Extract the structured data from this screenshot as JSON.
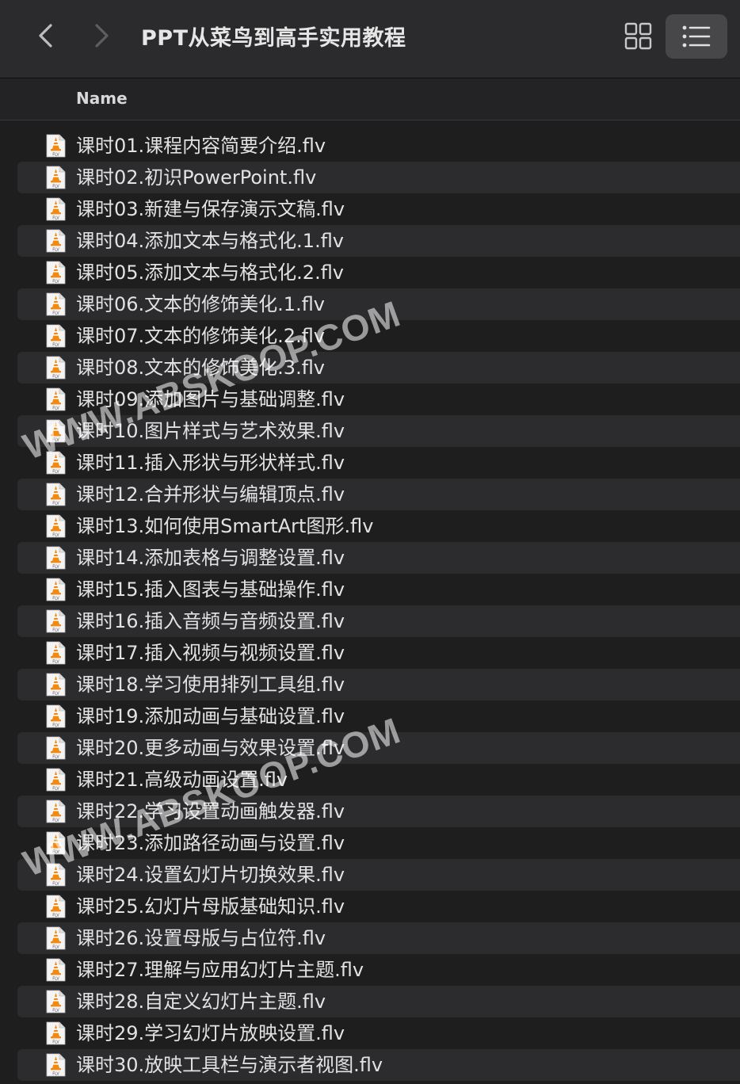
{
  "window": {
    "title": "PPT从菜鸟到高手实用教程"
  },
  "toolbar": {
    "back_icon": "chevron-left-icon",
    "forward_icon": "chevron-right-icon",
    "grid_view_icon": "grid-view-icon",
    "list_view_icon": "list-view-icon"
  },
  "header": {
    "name_label": "Name"
  },
  "files": [
    "课时01.课程内容简要介绍.flv",
    "课时02.初识PowerPoint.flv",
    "课时03.新建与保存演示文稿.flv",
    "课时04.添加文本与格式化.1.flv",
    "课时05.添加文本与格式化.2.flv",
    "课时06.文本的修饰美化.1.flv",
    "课时07.文本的修饰美化.2.flv",
    "课时08.文本的修饰美化.3.flv",
    "课时09.添加图片与基础调整.flv",
    "课时10.图片样式与艺术效果.flv",
    "课时11.插入形状与形状样式.flv",
    "课时12.合并形状与编辑顶点.flv",
    "课时13.如何使用SmartArt图形.flv",
    "课时14.添加表格与调整设置.flv",
    "课时15.插入图表与基础操作.flv",
    "课时16.插入音频与音频设置.flv",
    "课时17.插入视频与视频设置.flv",
    "课时18.学习使用排列工具组.flv",
    "课时19.添加动画与基础设置.flv",
    "课时20.更多动画与效果设置.flv",
    "课时21.高级动画设置.flv",
    "课时22.学习设置动画触发器.flv",
    "课时23.添加路径动画与设置.flv",
    "课时24.设置幻灯片切换效果.flv",
    "课时25.幻灯片母版基础知识.flv",
    "课时26.设置母版与占位符.flv",
    "课时27.理解与应用幻灯片主题.flv",
    "课时28.自定义幻灯片主题.flv",
    "课时29.学习幻灯片放映设置.flv",
    "课时30.放映工具栏与演示者视图.flv"
  ],
  "file_icon": "vlc-flv-file-icon",
  "watermarks": [
    "WWW.ABSKOOP.COM",
    "WWW.ABSKOOP.COM"
  ],
  "colors": {
    "toolbar_bg": "#2b2b2d",
    "list_bg": "#1e1e1e",
    "alt_row_bg": "#2c2c2e",
    "text": "#e2e2e2",
    "selected_view_bg": "#47474a",
    "vlc_orange": "#f08a12"
  }
}
